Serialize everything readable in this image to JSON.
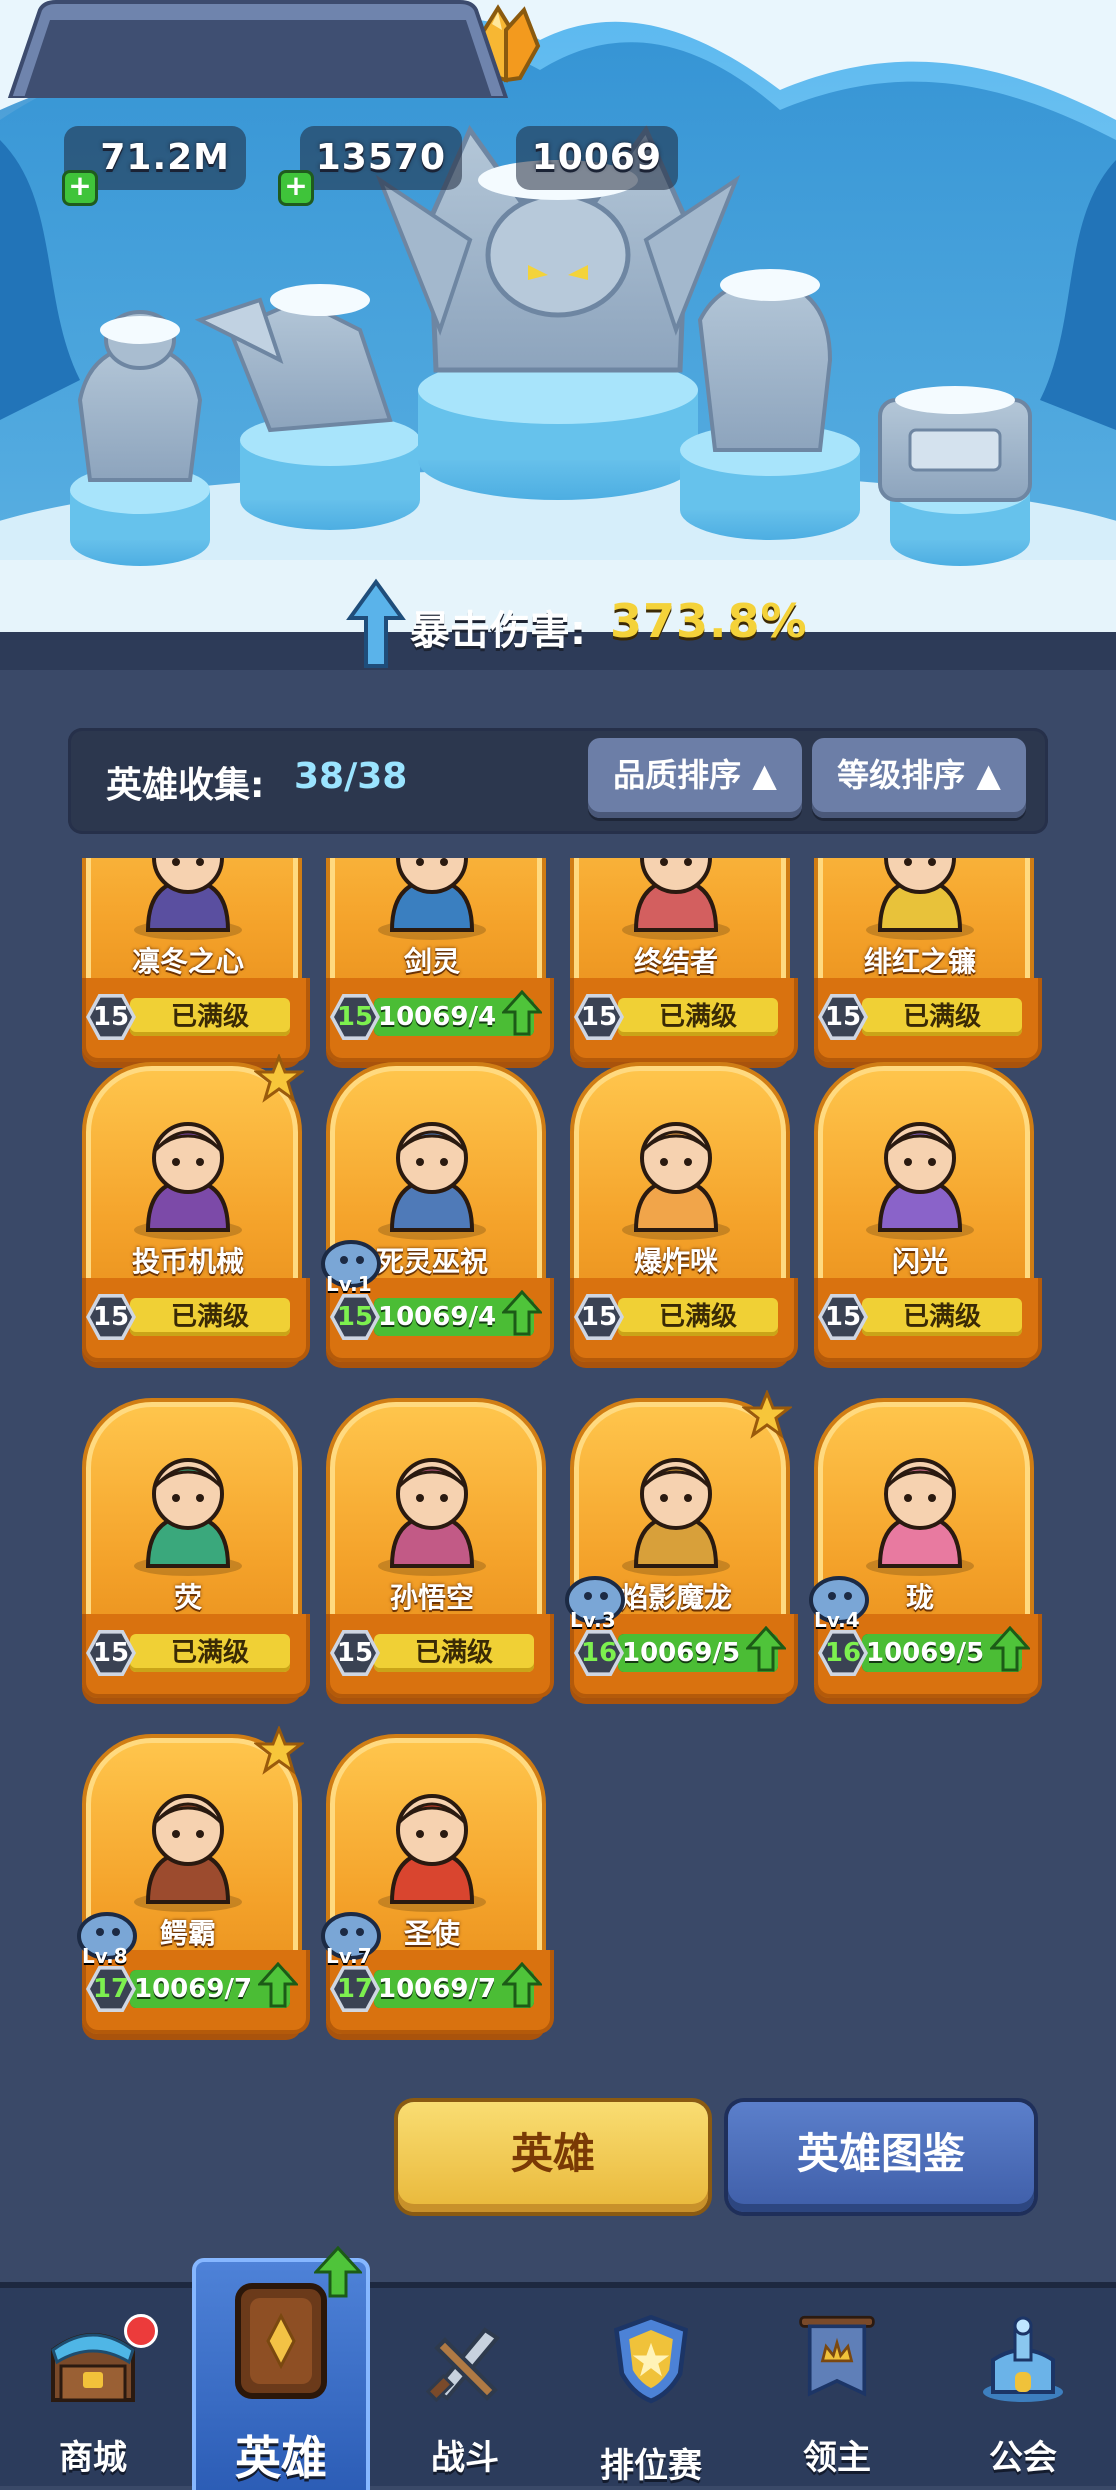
{
  "currencies": [
    {
      "id": "gold",
      "value": "71.2M"
    },
    {
      "id": "crystal",
      "value": "13570"
    },
    {
      "id": "shard",
      "value": "10069"
    }
  ],
  "crit": {
    "label": "暴击伤害:",
    "value": "373.8%"
  },
  "collection": {
    "label": "英雄收集:",
    "count": "38/38"
  },
  "sort": {
    "quality": "品质排序",
    "level": "等级排序"
  },
  "colors": {
    "accent_gold": "#f4d23a",
    "progress_green": "#4bbd35",
    "card_orange": "#f4a22a",
    "nav_blue": "#2c3c5c"
  },
  "heroes": [
    {
      "name": "凛冬之心",
      "level": "15",
      "status": "已满级"
    },
    {
      "name": "剑灵",
      "level": "15",
      "progress": "10069/4",
      "progress_fraction": 1
    },
    {
      "name": "终结者",
      "level": "15",
      "status": "已满级"
    },
    {
      "name": "绯红之镰",
      "level": "15",
      "status": "已满级"
    },
    {
      "name": "投币机械",
      "level": "15",
      "status": "已满级",
      "starred": true
    },
    {
      "name": "死灵巫祝",
      "level": "15",
      "progress": "10069/4",
      "progress_fraction": 1,
      "pet_level": "Lv.1"
    },
    {
      "name": "爆炸咪",
      "level": "15",
      "status": "已满级"
    },
    {
      "name": "闪光",
      "level": "15",
      "status": "已满级"
    },
    {
      "name": "荧",
      "level": "15",
      "status": "已满级"
    },
    {
      "name": "孙悟空",
      "level": "15",
      "status": "已满级"
    },
    {
      "name": "焰影魔龙",
      "level": "16",
      "progress": "10069/5",
      "progress_fraction": 1,
      "pet_level": "Lv.3",
      "starred": true
    },
    {
      "name": "珑",
      "level": "16",
      "progress": "10069/5",
      "progress_fraction": 1,
      "pet_level": "Lv.4"
    },
    {
      "name": "鳄霸",
      "level": "17",
      "progress": "10069/7",
      "progress_fraction": 1,
      "pet_level": "Lv.8",
      "starred": true
    },
    {
      "name": "圣使",
      "level": "17",
      "progress": "10069/7",
      "progress_fraction": 1,
      "pet_level": "Lv.7"
    }
  ],
  "buttons": {
    "hero": "英雄",
    "codex": "英雄图鉴"
  },
  "nav": [
    {
      "id": "shop",
      "label": "商城",
      "icon": "shop-icon"
    },
    {
      "id": "hero",
      "label": "英雄",
      "icon": "hero-card-icon",
      "active": true
    },
    {
      "id": "battle",
      "label": "战斗",
      "icon": "battle-icon"
    },
    {
      "id": "ranked",
      "label": "排位赛",
      "icon": "ranked-icon"
    },
    {
      "id": "lord",
      "label": "领主",
      "icon": "lord-banner-icon"
    },
    {
      "id": "guild",
      "label": "公会",
      "icon": "guild-icon"
    }
  ]
}
